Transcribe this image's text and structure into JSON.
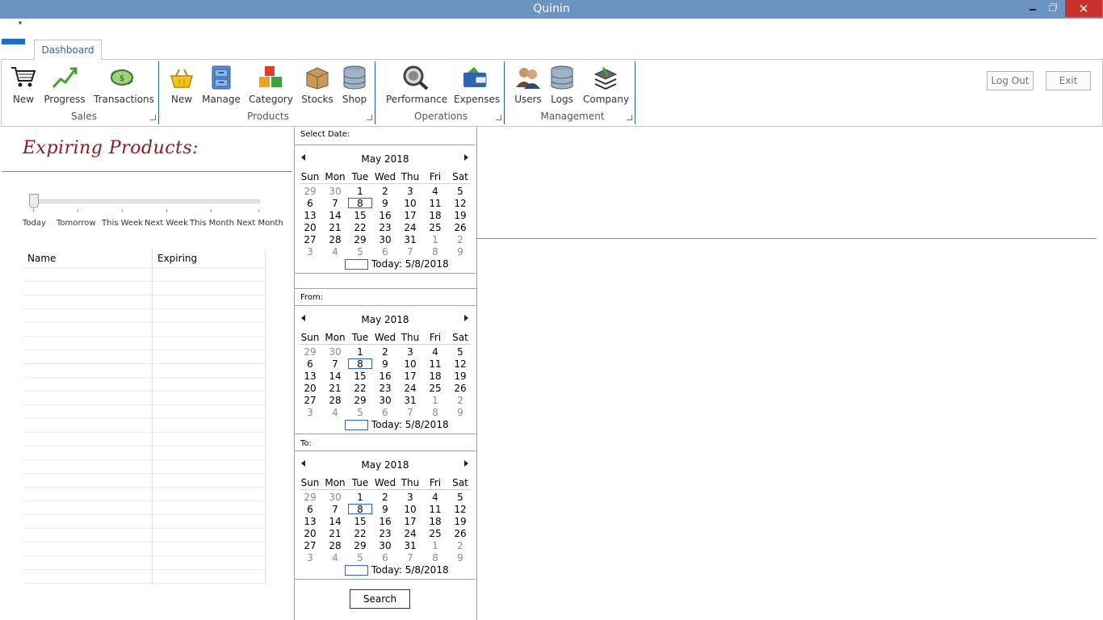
{
  "window": {
    "title": "Quinin",
    "close_glyph": "✕"
  },
  "ribbon": {
    "tab": "Dashboard",
    "groups": [
      {
        "label": "Sales",
        "buttons": [
          {
            "label": "New",
            "icon": "cart-icon"
          },
          {
            "label": "Progress",
            "icon": "trend-icon"
          },
          {
            "label": "Transactions",
            "icon": "money-exchange-icon"
          }
        ]
      },
      {
        "label": "Products",
        "buttons": [
          {
            "label": "New",
            "icon": "basket-icon"
          },
          {
            "label": "Manage",
            "icon": "cabinet-icon"
          },
          {
            "label": "Category",
            "icon": "cubes-icon"
          },
          {
            "label": "Stocks",
            "icon": "box-icon"
          },
          {
            "label": "Shop",
            "icon": "database-icon"
          }
        ]
      },
      {
        "label": "Operations",
        "buttons": [
          {
            "label": "Performance",
            "icon": "magnifier-icon"
          },
          {
            "label": "Expenses",
            "icon": "wallet-icon"
          }
        ]
      },
      {
        "label": "Management",
        "buttons": [
          {
            "label": "Users",
            "icon": "users-icon"
          },
          {
            "label": "Logs",
            "icon": "database-icon"
          },
          {
            "label": "Company",
            "icon": "stack-icon"
          }
        ]
      }
    ],
    "logout": "Log Out",
    "exit": "Exit"
  },
  "expiring": {
    "title": "Expiring Products:",
    "slider_labels": [
      "Today",
      "Tomorrow",
      "This Week",
      "Next Week",
      "This Month",
      "Next Month"
    ],
    "slider_value_index": 0,
    "columns": [
      "Name",
      "Expiring"
    ]
  },
  "dates": {
    "select_label": "Select Date:",
    "from_label": "From:",
    "to_label": "To:",
    "month": "May 2018",
    "dow": [
      "Sun",
      "Mon",
      "Tue",
      "Wed",
      "Thu",
      "Fri",
      "Sat"
    ],
    "weeks": [
      [
        "29",
        "30",
        "1",
        "2",
        "3",
        "4",
        "5"
      ],
      [
        "6",
        "7",
        "8",
        "9",
        "10",
        "11",
        "12"
      ],
      [
        "13",
        "14",
        "15",
        "16",
        "17",
        "18",
        "19"
      ],
      [
        "20",
        "21",
        "22",
        "23",
        "24",
        "25",
        "26"
      ],
      [
        "27",
        "28",
        "29",
        "30",
        "31",
        "1",
        "2"
      ],
      [
        "3",
        "4",
        "5",
        "6",
        "7",
        "8",
        "9"
      ]
    ],
    "selected_day": "8",
    "today_text": "Today: 5/8/2018",
    "search": "Search"
  },
  "colors": {
    "titlebar": "#6b95c0",
    "accent": "#2a66b5",
    "close": "#c7302b",
    "heading": "#8b1a1a"
  }
}
